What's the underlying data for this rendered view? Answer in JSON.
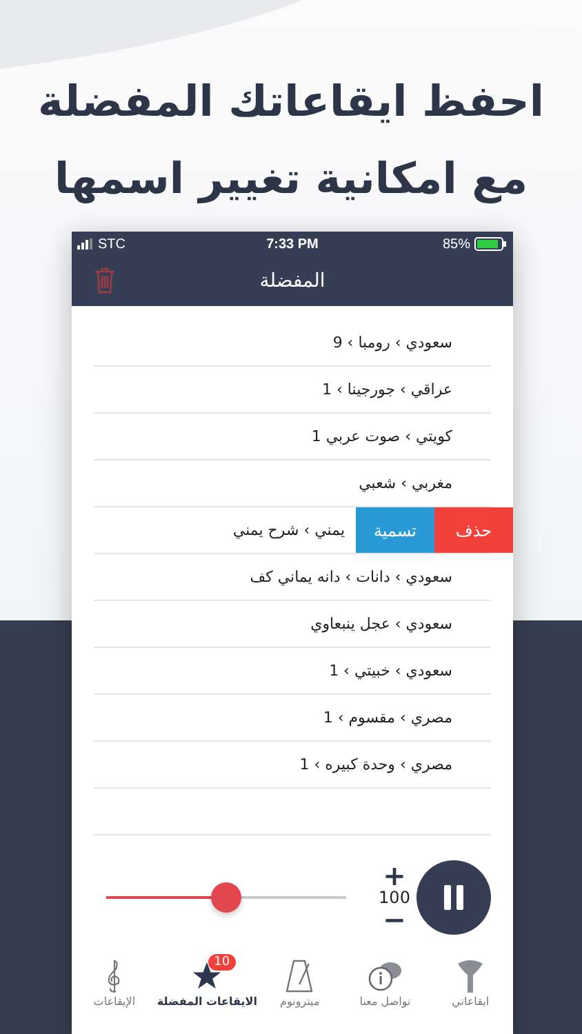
{
  "headline": [
    "احفظ ايقاعاتك المفضلة",
    "مع امكانية تغيير اسمها"
  ],
  "status_bar": {
    "carrier": "STC",
    "time": "7:33 PM",
    "battery": "85%"
  },
  "nav": {
    "title": "المفضلة"
  },
  "rows": [
    {
      "kind": "plain",
      "text": "سعودي › رومبا › 9"
    },
    {
      "kind": "plain",
      "text": "عراقي › جورجينا › 1"
    },
    {
      "kind": "plain",
      "text": "كويتي › صوت عربي 1"
    },
    {
      "kind": "plain",
      "text": "مغربي › شعبي"
    },
    {
      "kind": "swiped",
      "text": "يمني › شرح يمني",
      "actions": [
        {
          "label": "حذف",
          "color": "#f2413a"
        },
        {
          "label": "تسمية",
          "color": "#2a9ad6"
        }
      ]
    },
    {
      "kind": "plain",
      "text": "سعودي › دانات › دانه يماني كف"
    },
    {
      "kind": "plain",
      "text": "سعودي › عجل ينبعاوي"
    },
    {
      "kind": "plain",
      "text": "سعودي › خبيتي › 1"
    },
    {
      "kind": "plain",
      "text": "مصري › مقسوم › 1"
    },
    {
      "kind": "plain",
      "text": "مصري › وحدة كبيره › 1"
    }
  ],
  "player": {
    "level": 0.5,
    "tempo": "100",
    "plus": "+",
    "minus": "−"
  },
  "tabs": [
    {
      "label": "ايقاعاتي",
      "kind": "drum",
      "selected": false
    },
    {
      "label": "تواصل معنا",
      "kind": "chat",
      "selected": false
    },
    {
      "label": "ميترونوم",
      "kind": "metronome",
      "selected": false
    },
    {
      "label": "الايقاعات المفضلة",
      "kind": "star",
      "selected": true,
      "badge": "10"
    },
    {
      "label": "الإيقاعات",
      "kind": "clef",
      "selected": false
    }
  ]
}
